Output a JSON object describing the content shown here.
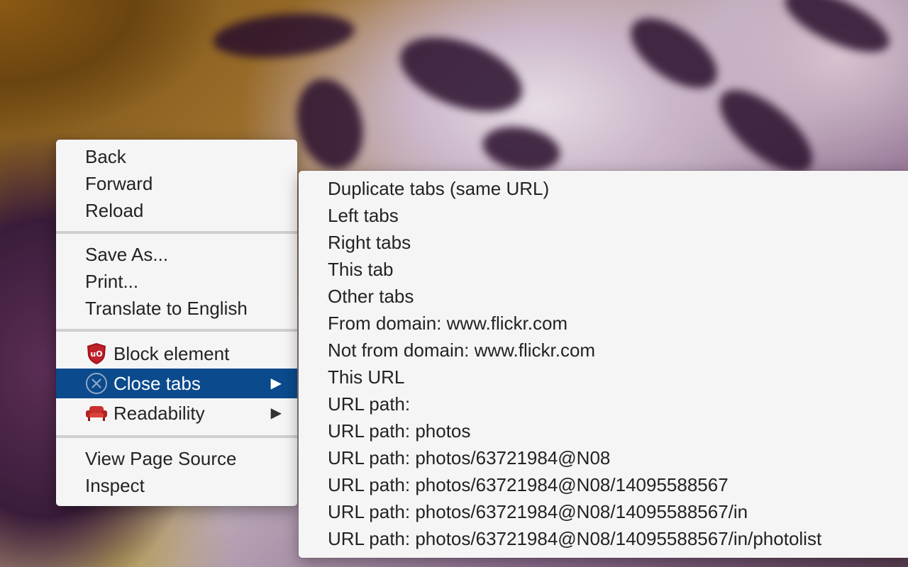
{
  "context_menu": {
    "items": [
      {
        "label": "Back"
      },
      {
        "label": "Forward"
      },
      {
        "label": "Reload"
      },
      {
        "label": "Save As..."
      },
      {
        "label": "Print..."
      },
      {
        "label": "Translate to English"
      },
      {
        "label": "Block element",
        "icon": "ublock-shield-icon"
      },
      {
        "label": "Close tabs",
        "icon": "close-circle-icon",
        "submenu_arrow": "▶"
      },
      {
        "label": "Readability",
        "icon": "armchair-icon",
        "submenu_arrow": "▶"
      },
      {
        "label": "View Page Source"
      },
      {
        "label": "Inspect"
      }
    ],
    "highlighted_item": "Close tabs",
    "highlight_color": "#0b4a8c"
  },
  "close_tabs_submenu": {
    "items": [
      "Duplicate tabs (same URL)",
      "Left tabs",
      "Right tabs",
      "This tab",
      "Other tabs",
      "From domain: www.flickr.com",
      "Not from domain: www.flickr.com",
      "This URL",
      "URL path:",
      "URL path: photos",
      "URL path: photos/63721984@N08",
      "URL path: photos/63721984@N08/14095588567",
      "URL path: photos/63721984@N08/14095588567/in",
      "URL path: photos/63721984@N08/14095588567/in/photolist"
    ]
  },
  "colors": {
    "menu_background": "#f5f5f5",
    "text": "#232323",
    "ublock_red": "#a3141d"
  }
}
